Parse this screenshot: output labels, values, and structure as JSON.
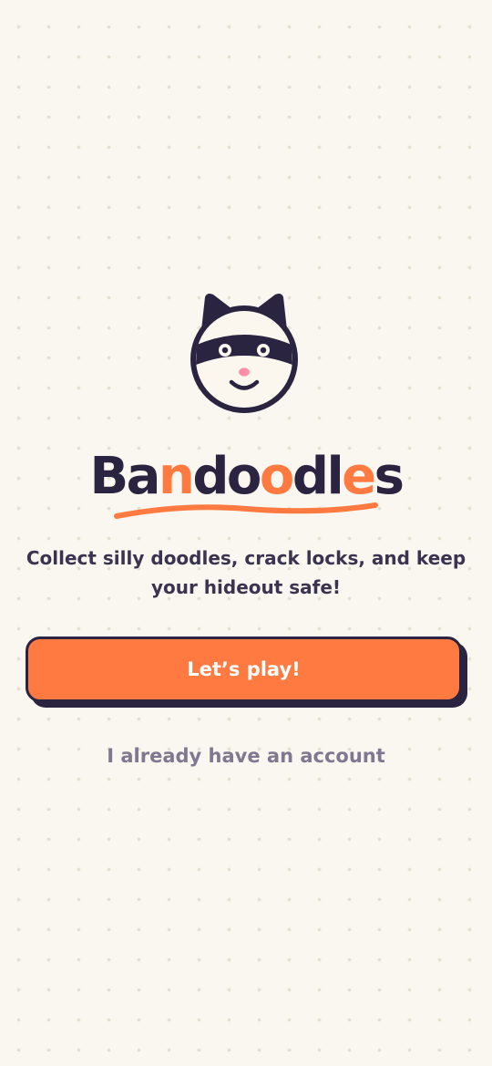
{
  "brand": {
    "name_parts": [
      "Ba",
      "n",
      "do",
      "o",
      "dl",
      "e",
      "s"
    ],
    "logo_text": "Bandoodles",
    "accent_color": "#FF7A40",
    "ink_color": "#2A2440"
  },
  "mascot": {
    "icon": "raccoon-mascot-icon"
  },
  "hero": {
    "tagline": "Collect silly doodles, crack locks, and keep your hideout safe!"
  },
  "actions": {
    "primary_label": "Let’s play!",
    "secondary_label": "I already have an account"
  },
  "colors": {
    "background": "#FAF7F0",
    "primary_button": "#FF7A40",
    "outline": "#2A2440",
    "muted_text": "#7E7890"
  }
}
